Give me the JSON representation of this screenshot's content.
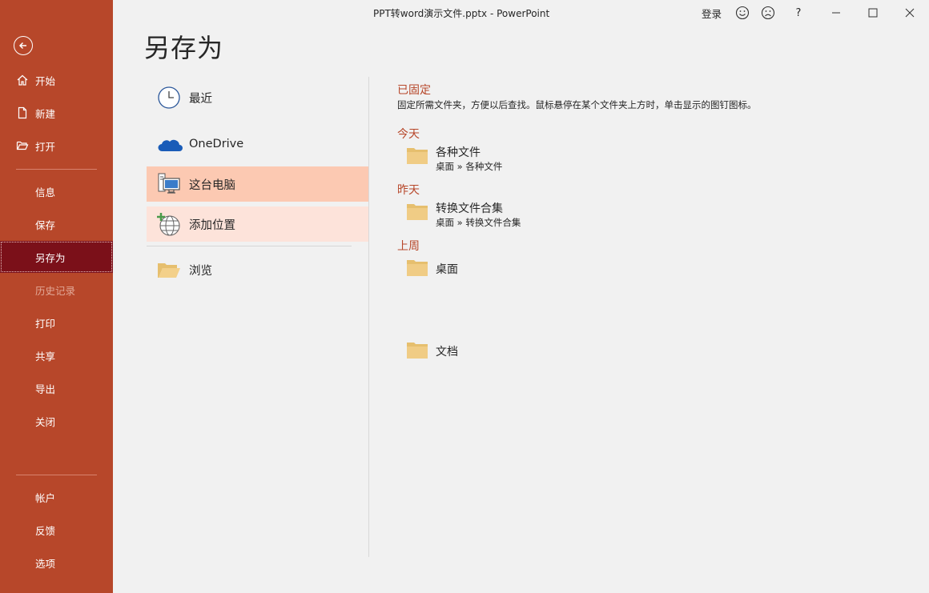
{
  "window": {
    "title": "PPT转word演示文件.pptx  -  PowerPoint",
    "signin": "登录",
    "help": "?"
  },
  "sidebar": {
    "items": [
      {
        "label": "开始",
        "icon": "home-icon"
      },
      {
        "label": "新建",
        "icon": "new-document-icon"
      },
      {
        "label": "打开",
        "icon": "open-folder-icon"
      },
      {
        "label": "信息"
      },
      {
        "label": "保存"
      },
      {
        "label": "另存为",
        "active": true
      },
      {
        "label": "历史记录",
        "disabled": true
      },
      {
        "label": "打印"
      },
      {
        "label": "共享"
      },
      {
        "label": "导出"
      },
      {
        "label": "关闭"
      },
      {
        "label": "帐户"
      },
      {
        "label": "反馈"
      },
      {
        "label": "选项"
      }
    ],
    "color": "#b7472a",
    "active_color": "#7b1019"
  },
  "main": {
    "title": "另存为",
    "locations": [
      {
        "label": "最近",
        "icon": "clock-icon"
      },
      {
        "label": "OneDrive",
        "icon": "cloud-icon"
      },
      {
        "label": "这台电脑",
        "icon": "computer-icon",
        "selected": true
      },
      {
        "label": "添加位置",
        "icon": "globe-add-icon"
      },
      {
        "label": "浏览",
        "icon": "browse-folder-icon"
      }
    ]
  },
  "right_pane": {
    "pinned": {
      "heading": "已固定",
      "description": "固定所需文件夹，方便以后查找。鼠标悬停在某个文件夹上方时，单击显示的图钉图标。"
    },
    "groups": [
      {
        "heading": "今天",
        "folders": [
          {
            "name": "各种文件",
            "path": "桌面 » 各种文件"
          }
        ]
      },
      {
        "heading": "昨天",
        "folders": [
          {
            "name": "转换文件合集",
            "path": "桌面 » 转换文件合集"
          }
        ]
      },
      {
        "heading": "上周",
        "folders": [
          {
            "name": "桌面",
            "path": ""
          },
          {
            "name": "文档",
            "path": ""
          }
        ]
      }
    ]
  }
}
